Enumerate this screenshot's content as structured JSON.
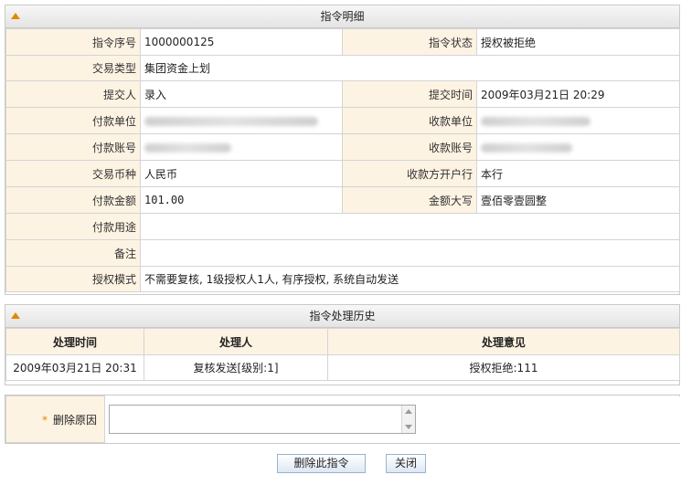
{
  "detail": {
    "title": "指令明细",
    "seq_label": "指令序号",
    "seq_value": "1000000125",
    "status_label": "指令状态",
    "status_value": "授权被拒绝",
    "type_label": "交易类型",
    "type_value": "集团资金上划",
    "submitter_label": "提交人",
    "submitter_value": "录入",
    "submit_time_label": "提交时间",
    "submit_time_value": "2009年03月21日 20:29",
    "payer_label": "付款单位",
    "payee_label": "收款单位",
    "payer_acct_label": "付款账号",
    "payee_acct_label": "收款账号",
    "currency_label": "交易币种",
    "currency_value": "人民币",
    "payee_bank_label": "收款方开户行",
    "payee_bank_value": "本行",
    "amount_label": "付款金额",
    "amount_value": "101.00",
    "amount_upper_label": "金额大写",
    "amount_upper_value": "壹佰零壹圆整",
    "purpose_label": "付款用途",
    "purpose_value": "",
    "remark_label": "备注",
    "remark_value": "",
    "auth_mode_label": "授权模式",
    "auth_mode_value": "不需要复核, 1级授权人1人, 有序授权, 系统自动发送"
  },
  "history": {
    "title": "指令处理历史",
    "columns": [
      "处理时间",
      "处理人",
      "处理意见"
    ],
    "rows": [
      [
        "2009年03月21日 20:31",
        "复核发送[级别:1]",
        "授权拒绝:111"
      ]
    ]
  },
  "delete_form": {
    "star": "*",
    "reason_label": "删除原因",
    "reason_value": ""
  },
  "buttons": {
    "delete_label": "删除此指令",
    "close_label": "关闭"
  },
  "colors": {
    "accent": "#e08a00",
    "label_bg": "#fdf3e3"
  }
}
